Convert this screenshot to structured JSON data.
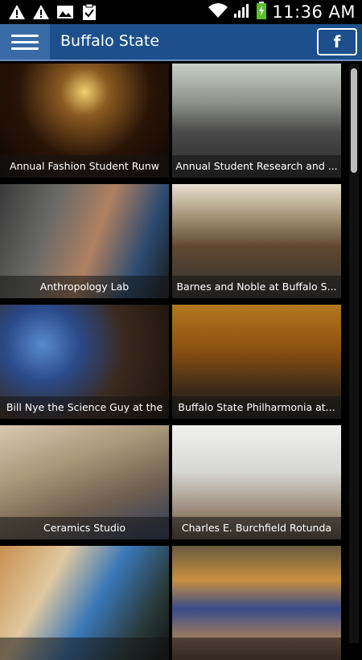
{
  "status_bar": {
    "time": "11:36 AM",
    "left_icons": [
      "warning-icon",
      "warning-icon",
      "image-icon",
      "clipboard-check-icon"
    ],
    "right_icons": [
      "wifi-icon",
      "signal-icon",
      "battery-charging-icon"
    ]
  },
  "app_bar": {
    "title": "Buffalo State",
    "facebook_label": "f",
    "color": "#1d4f8c"
  },
  "tiles": [
    {
      "caption": "Annual Fashion Student Runw"
    },
    {
      "caption": "Annual Student Research and ..."
    },
    {
      "caption": "Anthropology Lab"
    },
    {
      "caption": "Barnes and Noble at Buffalo S..."
    },
    {
      "caption": "Bill Nye the Science Guy at the"
    },
    {
      "caption": "Buffalo State Philharmonia at..."
    },
    {
      "caption": "Ceramics Studio"
    },
    {
      "caption": "Charles E. Burchfield Rotunda"
    },
    {
      "caption": ""
    },
    {
      "caption": ""
    }
  ]
}
